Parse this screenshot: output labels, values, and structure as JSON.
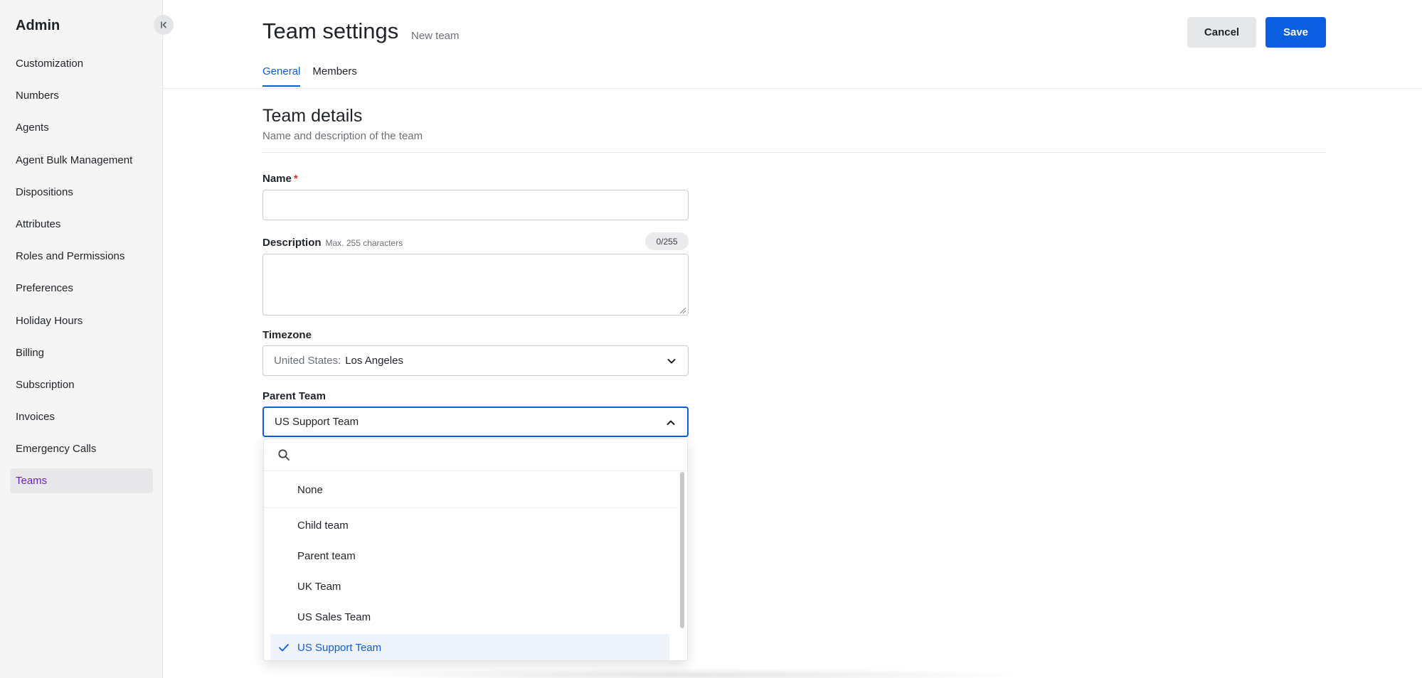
{
  "sidebar": {
    "title": "Admin",
    "items": [
      {
        "label": "Customization"
      },
      {
        "label": "Numbers"
      },
      {
        "label": "Agents"
      },
      {
        "label": "Agent Bulk Management"
      },
      {
        "label": "Dispositions"
      },
      {
        "label": "Attributes"
      },
      {
        "label": "Roles and Permissions"
      },
      {
        "label": "Preferences"
      },
      {
        "label": "Holiday Hours"
      },
      {
        "label": "Billing"
      },
      {
        "label": "Subscription"
      },
      {
        "label": "Invoices"
      },
      {
        "label": "Emergency Calls"
      },
      {
        "label": "Teams"
      }
    ],
    "active_item": "Teams",
    "collapse_icon": "collapse-left-icon"
  },
  "header": {
    "title": "Team settings",
    "subtitle": "New team",
    "cancel_label": "Cancel",
    "save_label": "Save",
    "tabs": [
      {
        "label": "General"
      },
      {
        "label": "Members"
      }
    ],
    "active_tab": "General"
  },
  "section": {
    "title": "Team details",
    "description": "Name and description of the team"
  },
  "form": {
    "name": {
      "label": "Name",
      "required_mark": "*",
      "value": ""
    },
    "description": {
      "label": "Description",
      "hint": "Max. 255 characters",
      "counter": "0/255",
      "value": ""
    },
    "timezone": {
      "label": "Timezone",
      "prefix": "United States:",
      "value": "Los Angeles"
    },
    "parent_team": {
      "label": "Parent Team",
      "value": "US Support Team"
    }
  },
  "dropdown": {
    "search_value": "",
    "options": [
      {
        "label": "None"
      },
      {
        "label": "Child team"
      },
      {
        "label": "Parent team"
      },
      {
        "label": "UK Team"
      },
      {
        "label": "US Sales Team"
      },
      {
        "label": "US Support Team"
      }
    ],
    "selected": "US Support Team"
  },
  "colors": {
    "accent": "#0b5ee0",
    "active_nav_text": "#6a1fc9",
    "required": "#d62b2b"
  }
}
